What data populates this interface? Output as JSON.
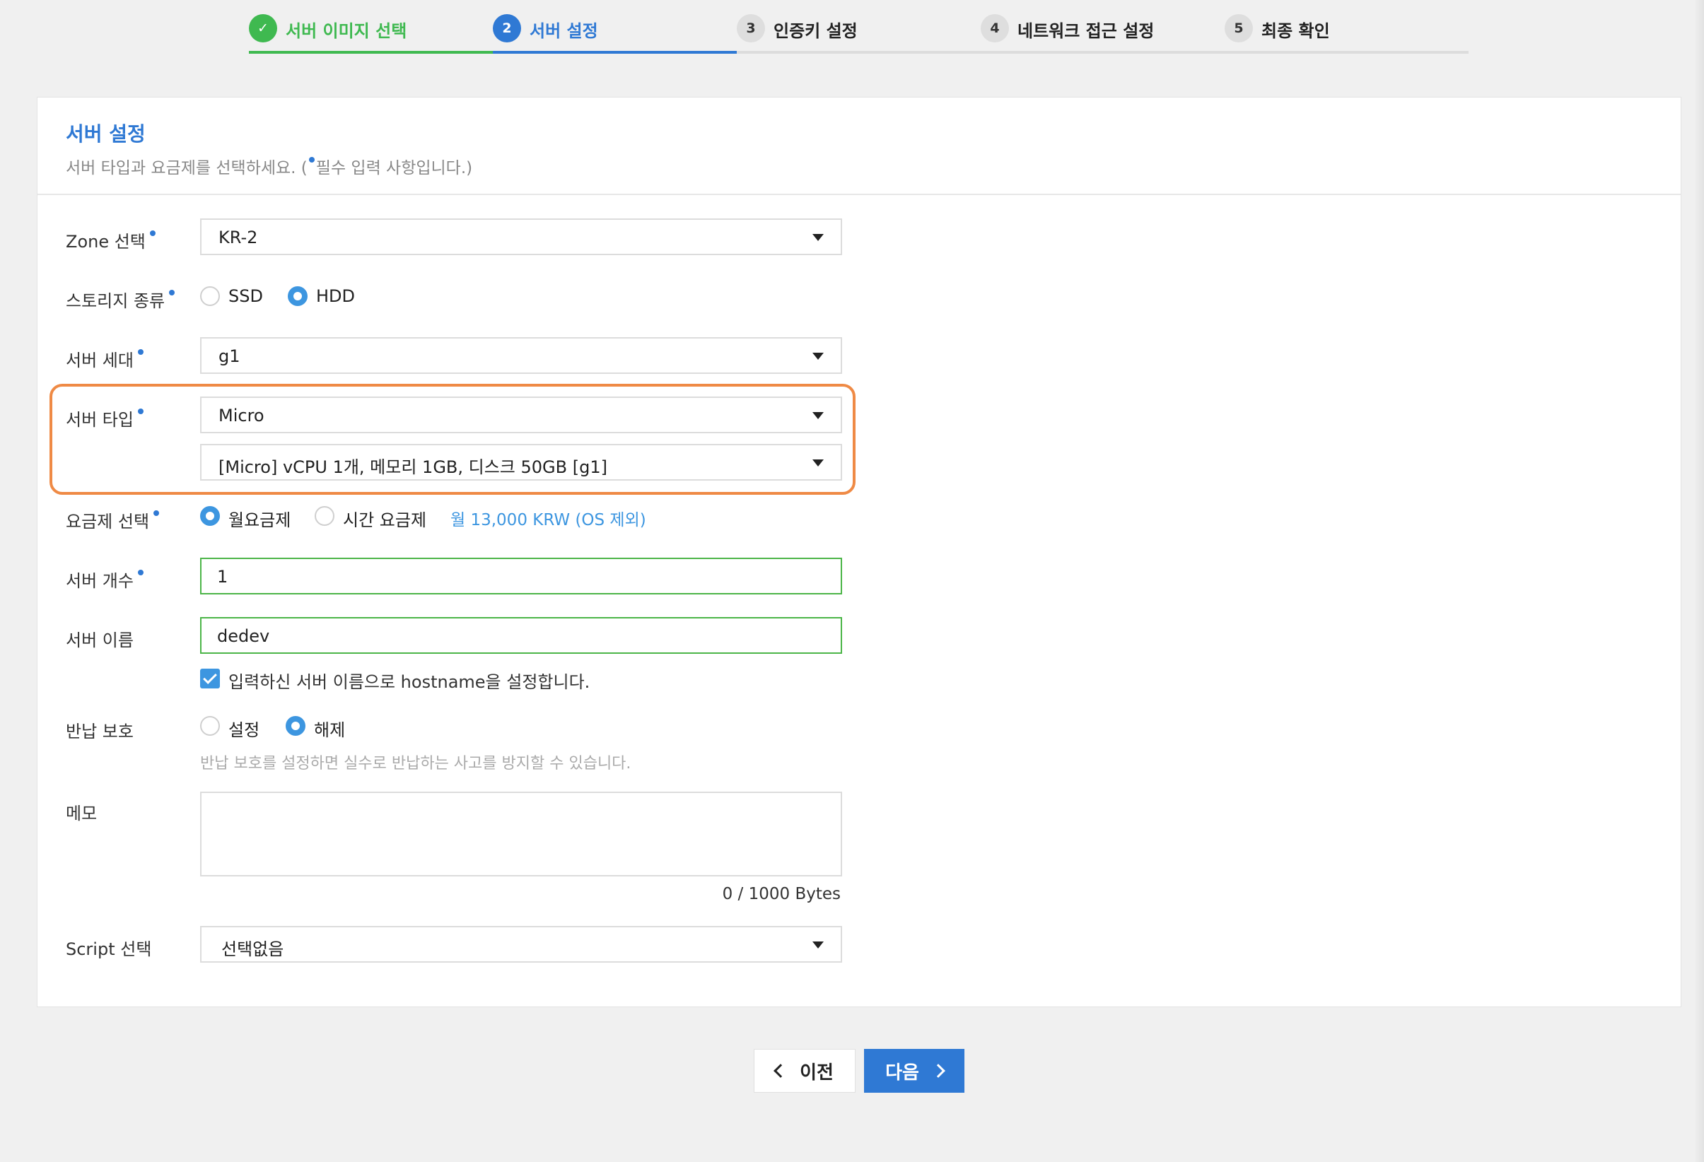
{
  "stepper": [
    {
      "num": "✓",
      "label": "서버 이미지 선택",
      "state": "done"
    },
    {
      "num": "2",
      "label": "서버 설정",
      "state": "active"
    },
    {
      "num": "3",
      "label": "인증키 설정",
      "state": "todo"
    },
    {
      "num": "4",
      "label": "네트워크 접근 설정",
      "state": "todo"
    },
    {
      "num": "5",
      "label": "최종 확인",
      "state": "todo"
    }
  ],
  "header": {
    "title": "서버 설정",
    "subtitle_pre": "서버 타입과 요금제를 선택하세요. (",
    "subtitle_post": "필수 입력 사항입니다.)"
  },
  "zone": {
    "label": "Zone 선택",
    "value": "KR-2"
  },
  "storage": {
    "label": "스토리지 종류",
    "options": [
      "SSD",
      "HDD"
    ],
    "selected": "HDD"
  },
  "generation": {
    "label": "서버 세대",
    "value": "g1"
  },
  "server_type": {
    "label": "서버 타입",
    "type_value": "Micro",
    "spec_value": "[Micro] vCPU 1개, 메모리 1GB, 디스크 50GB [g1]"
  },
  "plan": {
    "label": "요금제 선택",
    "options": [
      "월요금제",
      "시간 요금제"
    ],
    "selected": "월요금제",
    "price": "월 13,000 KRW (OS 제외)"
  },
  "count": {
    "label": "서버 개수",
    "value": "1"
  },
  "name": {
    "label": "서버 이름",
    "value": "dedev",
    "hostname_check_label": "입력하신 서버 이름으로 hostname을 설정합니다.",
    "hostname_checked": true
  },
  "protection": {
    "label": "반납 보호",
    "options": [
      "설정",
      "해제"
    ],
    "selected": "해제",
    "hint": "반납 보호를 설정하면 실수로 반납하는 사고를 방지할 수 있습니다."
  },
  "memo": {
    "label": "메모",
    "value": "",
    "counter": "0 / 1000 Bytes"
  },
  "script": {
    "label": "Script 선택",
    "value": "선택없음"
  },
  "buttons": {
    "prev": "이전",
    "next": "다음"
  },
  "colors": {
    "primary": "#2f79d4",
    "success": "#3fb950",
    "highlight": "#ef8a45",
    "radio": "#3d96e0"
  }
}
